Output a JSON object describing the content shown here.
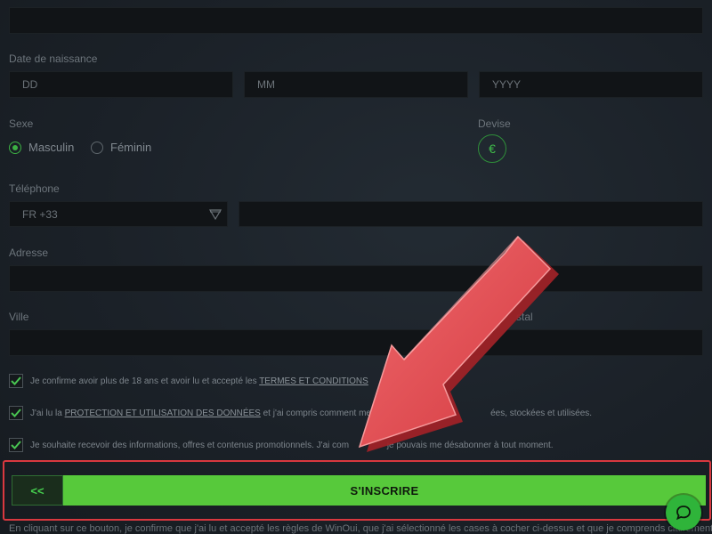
{
  "form": {
    "dob_label": "Date de naissance",
    "dob_day_placeholder": "DD",
    "dob_month_placeholder": "MM",
    "dob_year_placeholder": "YYYY",
    "sex_label": "Sexe",
    "sex_options": [
      "Masculin",
      "Féminin"
    ],
    "sex_selected": "Masculin",
    "currency_label": "Devise",
    "currency_symbol": "€",
    "phone_label": "Téléphone",
    "phone_code": "FR +33",
    "address_label": "Adresse",
    "city_label": "Ville",
    "postal_label_partial": "stal"
  },
  "consents": [
    {
      "before": "Je confirme avoir plus de 18 ans et avoir lu et accepté les",
      "link": "TERMES ET CONDITIONS",
      "after": "",
      "checked": true
    },
    {
      "before": "J'ai lu la",
      "link": "PROTECTION ET UTILISATION DES DONNÉES",
      "after": "et j'ai compris comment mes d",
      "tail": "ées, stockées et utilisées.",
      "checked": true
    },
    {
      "before": "Je souhaite recevoir des informations, offres et contenus promotionnels. J'ai com",
      "link": "",
      "after": "",
      "tail": "je pouvais me désabonner à tout moment.",
      "checked": true
    }
  ],
  "actions": {
    "back_label": "<<",
    "submit_label": "S'INSCRIRE"
  },
  "footer": {
    "text": "En cliquant sur ce bouton, je confirme que j'ai lu et accepté les règles de WinOui, que j'ai sélectionné les cases à cocher ci-dessus et que je comprends clairement comment mes"
  },
  "colors": {
    "accent_green": "#57c93b",
    "highlight_red": "#d9383f",
    "arrow_red": "#e0464b"
  },
  "icons": {
    "chat": "chat-bubble-icon",
    "caret": "caret-down-icon",
    "check": "checkmark-icon"
  }
}
